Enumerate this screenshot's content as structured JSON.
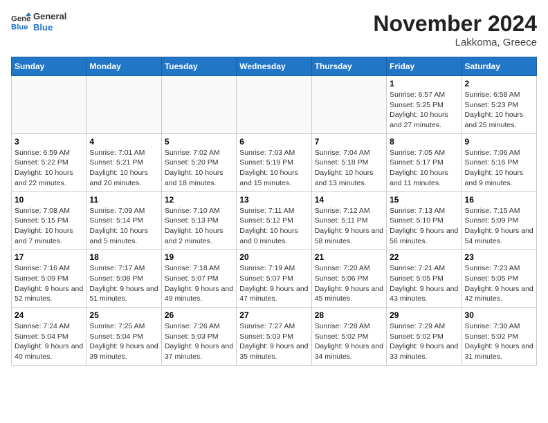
{
  "header": {
    "logo_line1": "General",
    "logo_line2": "Blue",
    "title": "November 2024",
    "subtitle": "Lakkoma, Greece"
  },
  "weekdays": [
    "Sunday",
    "Monday",
    "Tuesday",
    "Wednesday",
    "Thursday",
    "Friday",
    "Saturday"
  ],
  "weeks": [
    [
      {
        "day": "",
        "info": ""
      },
      {
        "day": "",
        "info": ""
      },
      {
        "day": "",
        "info": ""
      },
      {
        "day": "",
        "info": ""
      },
      {
        "day": "",
        "info": ""
      },
      {
        "day": "1",
        "info": "Sunrise: 6:57 AM\nSunset: 5:25 PM\nDaylight: 10 hours and 27 minutes."
      },
      {
        "day": "2",
        "info": "Sunrise: 6:58 AM\nSunset: 5:23 PM\nDaylight: 10 hours and 25 minutes."
      }
    ],
    [
      {
        "day": "3",
        "info": "Sunrise: 6:59 AM\nSunset: 5:22 PM\nDaylight: 10 hours and 22 minutes."
      },
      {
        "day": "4",
        "info": "Sunrise: 7:01 AM\nSunset: 5:21 PM\nDaylight: 10 hours and 20 minutes."
      },
      {
        "day": "5",
        "info": "Sunrise: 7:02 AM\nSunset: 5:20 PM\nDaylight: 10 hours and 18 minutes."
      },
      {
        "day": "6",
        "info": "Sunrise: 7:03 AM\nSunset: 5:19 PM\nDaylight: 10 hours and 15 minutes."
      },
      {
        "day": "7",
        "info": "Sunrise: 7:04 AM\nSunset: 5:18 PM\nDaylight: 10 hours and 13 minutes."
      },
      {
        "day": "8",
        "info": "Sunrise: 7:05 AM\nSunset: 5:17 PM\nDaylight: 10 hours and 11 minutes."
      },
      {
        "day": "9",
        "info": "Sunrise: 7:06 AM\nSunset: 5:16 PM\nDaylight: 10 hours and 9 minutes."
      }
    ],
    [
      {
        "day": "10",
        "info": "Sunrise: 7:08 AM\nSunset: 5:15 PM\nDaylight: 10 hours and 7 minutes."
      },
      {
        "day": "11",
        "info": "Sunrise: 7:09 AM\nSunset: 5:14 PM\nDaylight: 10 hours and 5 minutes."
      },
      {
        "day": "12",
        "info": "Sunrise: 7:10 AM\nSunset: 5:13 PM\nDaylight: 10 hours and 2 minutes."
      },
      {
        "day": "13",
        "info": "Sunrise: 7:11 AM\nSunset: 5:12 PM\nDaylight: 10 hours and 0 minutes."
      },
      {
        "day": "14",
        "info": "Sunrise: 7:12 AM\nSunset: 5:11 PM\nDaylight: 9 hours and 58 minutes."
      },
      {
        "day": "15",
        "info": "Sunrise: 7:13 AM\nSunset: 5:10 PM\nDaylight: 9 hours and 56 minutes."
      },
      {
        "day": "16",
        "info": "Sunrise: 7:15 AM\nSunset: 5:09 PM\nDaylight: 9 hours and 54 minutes."
      }
    ],
    [
      {
        "day": "17",
        "info": "Sunrise: 7:16 AM\nSunset: 5:09 PM\nDaylight: 9 hours and 52 minutes."
      },
      {
        "day": "18",
        "info": "Sunrise: 7:17 AM\nSunset: 5:08 PM\nDaylight: 9 hours and 51 minutes."
      },
      {
        "day": "19",
        "info": "Sunrise: 7:18 AM\nSunset: 5:07 PM\nDaylight: 9 hours and 49 minutes."
      },
      {
        "day": "20",
        "info": "Sunrise: 7:19 AM\nSunset: 5:07 PM\nDaylight: 9 hours and 47 minutes."
      },
      {
        "day": "21",
        "info": "Sunrise: 7:20 AM\nSunset: 5:06 PM\nDaylight: 9 hours and 45 minutes."
      },
      {
        "day": "22",
        "info": "Sunrise: 7:21 AM\nSunset: 5:05 PM\nDaylight: 9 hours and 43 minutes."
      },
      {
        "day": "23",
        "info": "Sunrise: 7:23 AM\nSunset: 5:05 PM\nDaylight: 9 hours and 42 minutes."
      }
    ],
    [
      {
        "day": "24",
        "info": "Sunrise: 7:24 AM\nSunset: 5:04 PM\nDaylight: 9 hours and 40 minutes."
      },
      {
        "day": "25",
        "info": "Sunrise: 7:25 AM\nSunset: 5:04 PM\nDaylight: 9 hours and 39 minutes."
      },
      {
        "day": "26",
        "info": "Sunrise: 7:26 AM\nSunset: 5:03 PM\nDaylight: 9 hours and 37 minutes."
      },
      {
        "day": "27",
        "info": "Sunrise: 7:27 AM\nSunset: 5:03 PM\nDaylight: 9 hours and 35 minutes."
      },
      {
        "day": "28",
        "info": "Sunrise: 7:28 AM\nSunset: 5:02 PM\nDaylight: 9 hours and 34 minutes."
      },
      {
        "day": "29",
        "info": "Sunrise: 7:29 AM\nSunset: 5:02 PM\nDaylight: 9 hours and 33 minutes."
      },
      {
        "day": "30",
        "info": "Sunrise: 7:30 AM\nSunset: 5:02 PM\nDaylight: 9 hours and 31 minutes."
      }
    ]
  ]
}
